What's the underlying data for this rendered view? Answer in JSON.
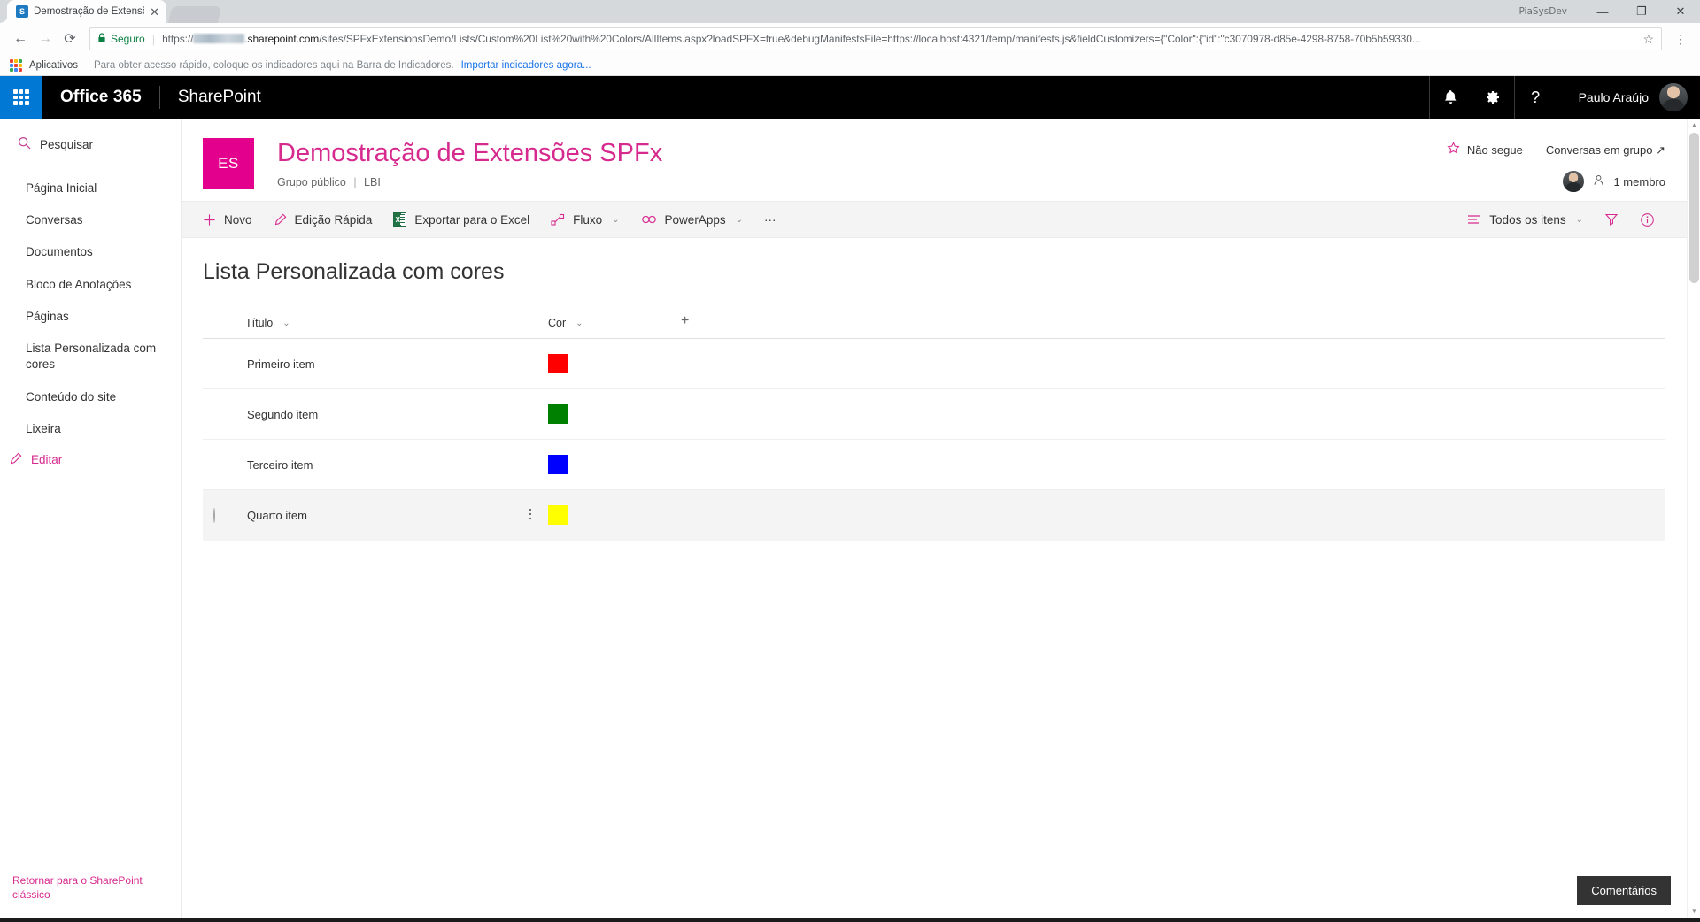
{
  "browser": {
    "tab": {
      "title": "Demostração de Extensõe",
      "favicon_label": "S",
      "close_icon": "✕"
    },
    "window": {
      "watermark": "PiaSysDev",
      "minimize": "—",
      "maximize": "❐",
      "close": "✕"
    },
    "nav": {
      "back": "←",
      "forward": "→",
      "reload": "⟳"
    },
    "omnibox": {
      "lock_icon": "🔒",
      "secure_label": "Seguro",
      "separator": "|",
      "url_scheme": "https://",
      "url_domain": ".sharepoint.com",
      "url_path": "/sites/SPFxExtensionsDemo/Lists/Custom%20List%20with%20Colors/AllItems.aspx?loadSPFX=true&debugManifestsFile=https://localhost:4321/temp/manifests.js&fieldCustomizers={\"Color\":{\"id\":\"c3070978-d85e-4298-8758-70b5b59330...",
      "star_icon": "☆",
      "menu_icon": "⋮"
    },
    "bookmarks": {
      "apps_label": "Aplicativos",
      "hint": "Para obter acesso rápido, coloque os indicadores aqui na Barra de Indicadores.",
      "import_link": "Importar indicadores agora..."
    }
  },
  "suitebar": {
    "waffle_name": "app-launcher",
    "brand": "Office 365",
    "app": "SharePoint",
    "notifications_icon": "🔔",
    "settings_icon": "⚙",
    "help_icon": "?",
    "user_name": "Paulo Araújo"
  },
  "sidebar": {
    "search_placeholder": "Pesquisar",
    "items": [
      {
        "label": "Página Inicial"
      },
      {
        "label": "Conversas"
      },
      {
        "label": "Documentos"
      },
      {
        "label": "Bloco de Anotações"
      },
      {
        "label": "Páginas"
      },
      {
        "label": "Lista Personalizada com cores"
      },
      {
        "label": "Conteúdo do site"
      },
      {
        "label": "Lixeira"
      }
    ],
    "edit_label": "Editar",
    "classic_link": "Retornar para o SharePoint clássico"
  },
  "site_header": {
    "logo_initials": "ES",
    "title": "Demostração de Extensões SPFx",
    "group_type": "Grupo público",
    "separator": "|",
    "classification": "LBI",
    "follow_label": "Não segue",
    "conversations_label": "Conversas em grupo ↗",
    "members_label": "1 membro"
  },
  "command_bar": {
    "new_label": "Novo",
    "quick_edit_label": "Edição Rápida",
    "export_excel_label": "Exportar para o Excel",
    "flow_label": "Fluxo",
    "powerapps_label": "PowerApps",
    "overflow_label": "···",
    "view_label": "Todos os itens",
    "filter_icon": "filter-icon",
    "info_icon": "information-icon"
  },
  "list": {
    "title": "Lista Personalizada com cores",
    "columns": [
      {
        "label": "Título"
      },
      {
        "label": "Cor"
      }
    ],
    "add_column_icon": "+",
    "rows": [
      {
        "title": "Primeiro item",
        "color": "#ff0000",
        "selected": false
      },
      {
        "title": "Segundo item",
        "color": "#008000",
        "selected": false
      },
      {
        "title": "Terceiro item",
        "color": "#0000ff",
        "selected": false
      },
      {
        "title": "Quarto item",
        "color": "#ffff00",
        "selected": true
      }
    ]
  },
  "comments": {
    "label": "Comentários"
  },
  "colors": {
    "accent_pink": "#d62a8e",
    "logo_pink": "#e3008c",
    "o365_blue": "#0078d4",
    "secure_green": "#0b8043"
  }
}
